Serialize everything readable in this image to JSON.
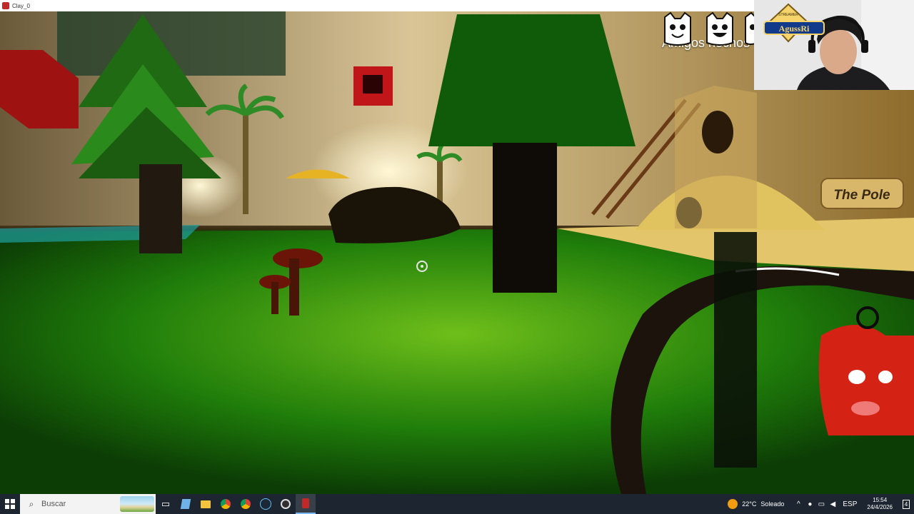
{
  "window": {
    "title": "Clay_0"
  },
  "hud": {
    "friends_title": "Amigos hechos",
    "friends_shown": 3
  },
  "world": {
    "sign_text": "The Pole"
  },
  "webcam": {
    "badge_text": "AgussRi",
    "badge_sub": "STREAMER"
  },
  "taskbar": {
    "search_placeholder": "Buscar",
    "pinned": [
      "task-view-icon",
      "notepad-icon",
      "file-explorer-icon",
      "chrome-icon",
      "chrome-alt-icon",
      "steam-icon",
      "obs-icon",
      "game-icon"
    ],
    "weather": {
      "temp": "22°C",
      "condition": "Soleado"
    },
    "language": "ESP",
    "time": "15:54",
    "date": "24/4/2026",
    "notifications": "4"
  },
  "colors": {
    "grass": "#1e7a0c",
    "taskbar": "#1c2530",
    "accent_red": "#c0282a"
  }
}
